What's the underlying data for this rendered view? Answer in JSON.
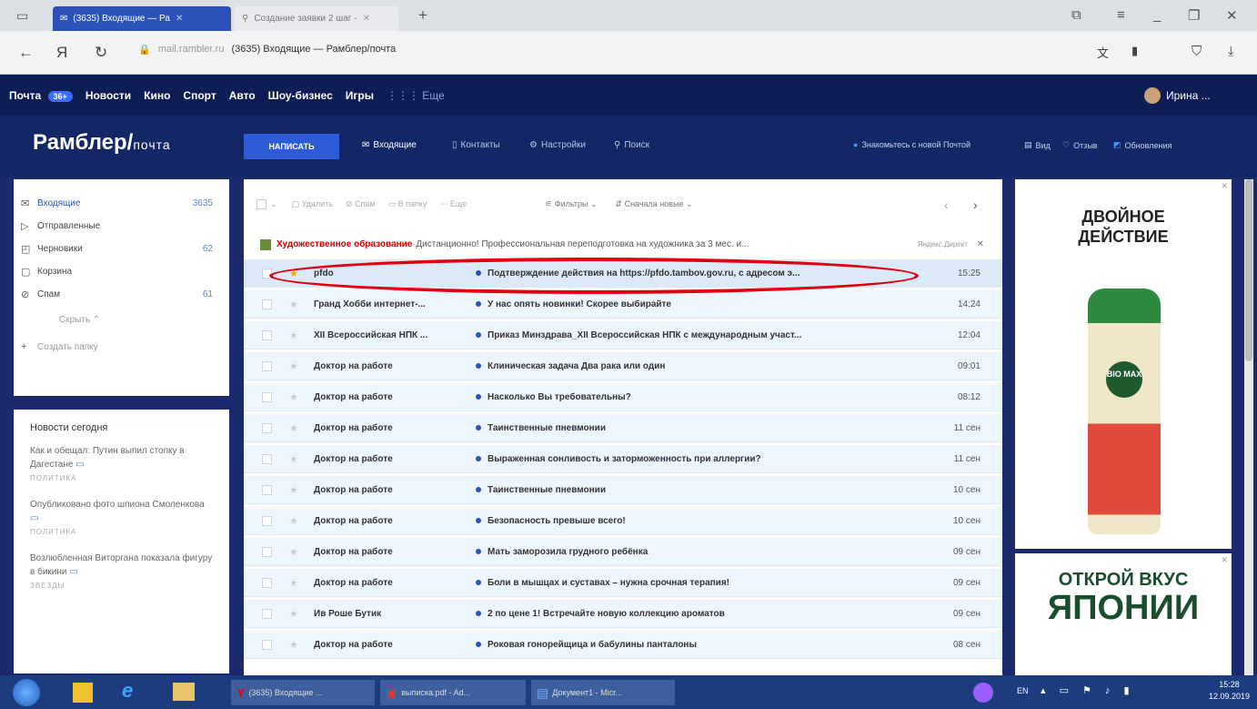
{
  "browser": {
    "tabs": [
      {
        "label": "(3635) Входящие — Ра"
      },
      {
        "label": "Создание заявки 2 шаг -"
      }
    ],
    "address_host": "mail.rambler.ru",
    "address_title": "(3635) Входящие — Рамблер/почта"
  },
  "topnav": {
    "items": [
      "Почта",
      "Новости",
      "Кино",
      "Спорт",
      "Авто",
      "Шоу-бизнес",
      "Игры",
      "Еще"
    ],
    "mail_badge": "36+",
    "user": "Ирина ..."
  },
  "header": {
    "logo": "Рамблер/",
    "logo_suffix": "почта",
    "compose": "НАПИСАТЬ",
    "links": [
      "Входящие",
      "Контакты",
      "Настройки",
      "Поиск"
    ],
    "right_links": [
      "Знакомьтесь с новой Почтой",
      "Вид",
      "Отзыв",
      "Обновления"
    ]
  },
  "folders": [
    {
      "label": "Входящие",
      "count": "3635",
      "icon": "inbox-icon"
    },
    {
      "label": "Отправленные",
      "count": "",
      "icon": "send-icon"
    },
    {
      "label": "Черновики",
      "count": "62",
      "icon": "draft-icon"
    },
    {
      "label": "Корзина",
      "count": "",
      "icon": "trash-icon"
    },
    {
      "label": "Спам",
      "count": "61",
      "icon": "spam-icon"
    },
    {
      "label": "Скрыть ⌃",
      "count": "",
      "icon": ""
    },
    {
      "label": "Создать папку",
      "count": "",
      "icon": "plus-icon"
    }
  ],
  "news": {
    "title": "Новости сегодня",
    "items": [
      {
        "text": "Как и обещал: Путин выпил стопку в Дагестане",
        "cat": "ПОЛИТИКА"
      },
      {
        "text": "Опубликовано фото шпиона Смоленкова",
        "cat": "ПОЛИТИКА"
      },
      {
        "text": "Возлюбленная Виторгана показала фигуру в бикини",
        "cat": "ЗВЕЗДЫ"
      }
    ]
  },
  "toolbar": {
    "items": [
      "Удалить",
      "Спам",
      "В папку",
      "Еще"
    ],
    "filters": "Фильтры",
    "sort": "Сначала новые"
  },
  "ad_row": {
    "title": "Художественное образование",
    "text": "Дистанционно! Профессиональная переподготовка на художника за 3 мес. и...",
    "label": "Яндекс.Директ"
  },
  "messages": [
    {
      "from": "pfdo",
      "subject": "Подтверждение действия на https://pfdo.tambov.gov.ru, с адресом э...",
      "date": "15:25",
      "fav": true
    },
    {
      "from": "Гранд Хобби интернет-...",
      "subject": "У нас опять новинки! Скорее выбирайте",
      "date": "14:24",
      "fav": false
    },
    {
      "from": "XII Всероссийская НПК ...",
      "subject": "Приказ Минздрава_XII Всероссийская НПК с международным участ...",
      "date": "12:04",
      "fav": false
    },
    {
      "from": "Доктор на работе",
      "subject": "Клиническая задача Два рака или один",
      "date": "09:01",
      "fav": false
    },
    {
      "from": "Доктор на работе",
      "subject": "Насколько Вы требовательны?",
      "date": "08:12",
      "fav": false
    },
    {
      "from": "Доктор на работе",
      "subject": "Таинственные пневмонии",
      "date": "11 сен",
      "fav": false
    },
    {
      "from": "Доктор на работе",
      "subject": "Выраженная сонливость и заторможенность при аллергии?",
      "date": "11 сен",
      "fav": false
    },
    {
      "from": "Доктор на работе",
      "subject": "Таинственные пневмонии",
      "date": "10 сен",
      "fav": false
    },
    {
      "from": "Доктор на работе",
      "subject": "Безопасность превыше всего!",
      "date": "10 сен",
      "fav": false
    },
    {
      "from": "Доктор на работе",
      "subject": "Мать заморозила грудного ребёнка",
      "date": "09 сен",
      "fav": false
    },
    {
      "from": "Доктор на работе",
      "subject": "Боли в мышцах и суставах – нужна срочная терапия!",
      "date": "09 сен",
      "fav": false
    },
    {
      "from": "Ив Роше Бутик",
      "subject": "2 по цене 1! Встречайте новую коллекцию ароматов",
      "date": "09 сен",
      "fav": false
    },
    {
      "from": "Доктор на работе",
      "subject": "Роковая гонорейщица и бабулины панталоны",
      "date": "08 сен",
      "fav": false
    }
  ],
  "ads": {
    "ad1_line1": "ДВОЙНОЕ",
    "ad1_line2": "ДЕЙСТВИЕ",
    "ad1_brand": "BIO MAX",
    "ad2_line1": "ОТКРОЙ ВКУС",
    "ad2_line2": "ЯПОНИИ"
  },
  "taskbar": {
    "items": [
      "(3635) Входящие ...",
      "выписка.pdf - Ad...",
      "Документ1 - Micr..."
    ],
    "lang": "EN",
    "time": "15:28",
    "date": "12.09.2019"
  }
}
